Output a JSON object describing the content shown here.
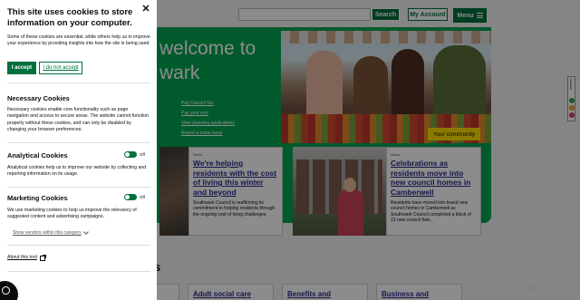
{
  "header": {
    "search_button": "Search",
    "account_button": "My Account",
    "menu_button": "Menu"
  },
  "hero": {
    "title": "welcome to\nwark",
    "quick_links": [
      "Pay Council Tax",
      "Pay your rent",
      "View planning applications",
      "Report a noise issue"
    ],
    "photo_tag": "Your community"
  },
  "news": [
    {
      "tag": "News",
      "title": "We're helping residents with the cost of living this winter and beyond",
      "text": "Southwark Council is reaffirming its commitment to helping residents through the ongoing cost of living challenges."
    },
    {
      "tag": "News",
      "title": "Celebrations as residents move into new council homes in Camberwell",
      "text": "Residents have moved into brand new council homes in Camberwell as Southwark Council completed a block of 13 new council flats."
    }
  ],
  "services": {
    "heading": "s",
    "items": [
      "il",
      "Adult social care",
      "Benefits and",
      "Business and"
    ]
  },
  "side_widget": {
    "label": "Feedback"
  },
  "cookie_panel": {
    "title": "This site uses cookies to store information on your computer.",
    "intro": "Some of these cookies are essential, while others help us to improve your experience by providing insights into how the site is being used.",
    "accept_label": "I accept",
    "reject_label": "I do not accept",
    "necessary": {
      "heading": "Necessary Cookies",
      "text": "Necessary cookies enable core functionality such as page navigation and access to secure areas. The website cannot function properly without these cookies, and can only be disabled by changing your browser preferences."
    },
    "analytical": {
      "heading": "Analytical Cookies",
      "text": "Analytical cookies help us to improve our website by collecting and reporting information on its usage.",
      "toggle_label": "Off"
    },
    "marketing": {
      "heading": "Marketing Cookies",
      "text": "We use marketing cookies to help us improve the relevancy of suggested content and advertising campaigns.",
      "toggle_label": "Off"
    },
    "vendors_link": "Show vendors within this category",
    "about_link": "About this tool"
  },
  "colors": {
    "brand_green": "#00703c",
    "hero_green": "#00a551",
    "link_blue": "#2a2c8c",
    "highlight_yellow": "#ffdd00"
  }
}
